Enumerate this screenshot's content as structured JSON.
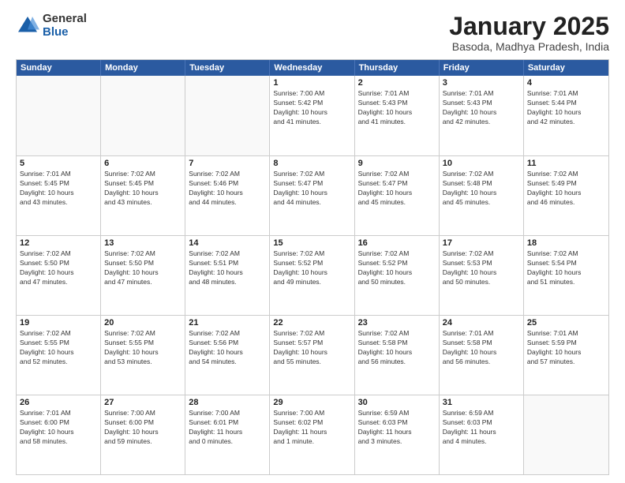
{
  "logo": {
    "general": "General",
    "blue": "Blue"
  },
  "title": "January 2025",
  "subtitle": "Basoda, Madhya Pradesh, India",
  "header_days": [
    "Sunday",
    "Monday",
    "Tuesday",
    "Wednesday",
    "Thursday",
    "Friday",
    "Saturday"
  ],
  "weeks": [
    [
      {
        "day": "",
        "info": ""
      },
      {
        "day": "",
        "info": ""
      },
      {
        "day": "",
        "info": ""
      },
      {
        "day": "1",
        "info": "Sunrise: 7:00 AM\nSunset: 5:42 PM\nDaylight: 10 hours\nand 41 minutes."
      },
      {
        "day": "2",
        "info": "Sunrise: 7:01 AM\nSunset: 5:43 PM\nDaylight: 10 hours\nand 41 minutes."
      },
      {
        "day": "3",
        "info": "Sunrise: 7:01 AM\nSunset: 5:43 PM\nDaylight: 10 hours\nand 42 minutes."
      },
      {
        "day": "4",
        "info": "Sunrise: 7:01 AM\nSunset: 5:44 PM\nDaylight: 10 hours\nand 42 minutes."
      }
    ],
    [
      {
        "day": "5",
        "info": "Sunrise: 7:01 AM\nSunset: 5:45 PM\nDaylight: 10 hours\nand 43 minutes."
      },
      {
        "day": "6",
        "info": "Sunrise: 7:02 AM\nSunset: 5:45 PM\nDaylight: 10 hours\nand 43 minutes."
      },
      {
        "day": "7",
        "info": "Sunrise: 7:02 AM\nSunset: 5:46 PM\nDaylight: 10 hours\nand 44 minutes."
      },
      {
        "day": "8",
        "info": "Sunrise: 7:02 AM\nSunset: 5:47 PM\nDaylight: 10 hours\nand 44 minutes."
      },
      {
        "day": "9",
        "info": "Sunrise: 7:02 AM\nSunset: 5:47 PM\nDaylight: 10 hours\nand 45 minutes."
      },
      {
        "day": "10",
        "info": "Sunrise: 7:02 AM\nSunset: 5:48 PM\nDaylight: 10 hours\nand 45 minutes."
      },
      {
        "day": "11",
        "info": "Sunrise: 7:02 AM\nSunset: 5:49 PM\nDaylight: 10 hours\nand 46 minutes."
      }
    ],
    [
      {
        "day": "12",
        "info": "Sunrise: 7:02 AM\nSunset: 5:50 PM\nDaylight: 10 hours\nand 47 minutes."
      },
      {
        "day": "13",
        "info": "Sunrise: 7:02 AM\nSunset: 5:50 PM\nDaylight: 10 hours\nand 47 minutes."
      },
      {
        "day": "14",
        "info": "Sunrise: 7:02 AM\nSunset: 5:51 PM\nDaylight: 10 hours\nand 48 minutes."
      },
      {
        "day": "15",
        "info": "Sunrise: 7:02 AM\nSunset: 5:52 PM\nDaylight: 10 hours\nand 49 minutes."
      },
      {
        "day": "16",
        "info": "Sunrise: 7:02 AM\nSunset: 5:52 PM\nDaylight: 10 hours\nand 50 minutes."
      },
      {
        "day": "17",
        "info": "Sunrise: 7:02 AM\nSunset: 5:53 PM\nDaylight: 10 hours\nand 50 minutes."
      },
      {
        "day": "18",
        "info": "Sunrise: 7:02 AM\nSunset: 5:54 PM\nDaylight: 10 hours\nand 51 minutes."
      }
    ],
    [
      {
        "day": "19",
        "info": "Sunrise: 7:02 AM\nSunset: 5:55 PM\nDaylight: 10 hours\nand 52 minutes."
      },
      {
        "day": "20",
        "info": "Sunrise: 7:02 AM\nSunset: 5:55 PM\nDaylight: 10 hours\nand 53 minutes."
      },
      {
        "day": "21",
        "info": "Sunrise: 7:02 AM\nSunset: 5:56 PM\nDaylight: 10 hours\nand 54 minutes."
      },
      {
        "day": "22",
        "info": "Sunrise: 7:02 AM\nSunset: 5:57 PM\nDaylight: 10 hours\nand 55 minutes."
      },
      {
        "day": "23",
        "info": "Sunrise: 7:02 AM\nSunset: 5:58 PM\nDaylight: 10 hours\nand 56 minutes."
      },
      {
        "day": "24",
        "info": "Sunrise: 7:01 AM\nSunset: 5:58 PM\nDaylight: 10 hours\nand 56 minutes."
      },
      {
        "day": "25",
        "info": "Sunrise: 7:01 AM\nSunset: 5:59 PM\nDaylight: 10 hours\nand 57 minutes."
      }
    ],
    [
      {
        "day": "26",
        "info": "Sunrise: 7:01 AM\nSunset: 6:00 PM\nDaylight: 10 hours\nand 58 minutes."
      },
      {
        "day": "27",
        "info": "Sunrise: 7:00 AM\nSunset: 6:00 PM\nDaylight: 10 hours\nand 59 minutes."
      },
      {
        "day": "28",
        "info": "Sunrise: 7:00 AM\nSunset: 6:01 PM\nDaylight: 11 hours\nand 0 minutes."
      },
      {
        "day": "29",
        "info": "Sunrise: 7:00 AM\nSunset: 6:02 PM\nDaylight: 11 hours\nand 1 minute."
      },
      {
        "day": "30",
        "info": "Sunrise: 6:59 AM\nSunset: 6:03 PM\nDaylight: 11 hours\nand 3 minutes."
      },
      {
        "day": "31",
        "info": "Sunrise: 6:59 AM\nSunset: 6:03 PM\nDaylight: 11 hours\nand 4 minutes."
      },
      {
        "day": "",
        "info": ""
      }
    ]
  ]
}
